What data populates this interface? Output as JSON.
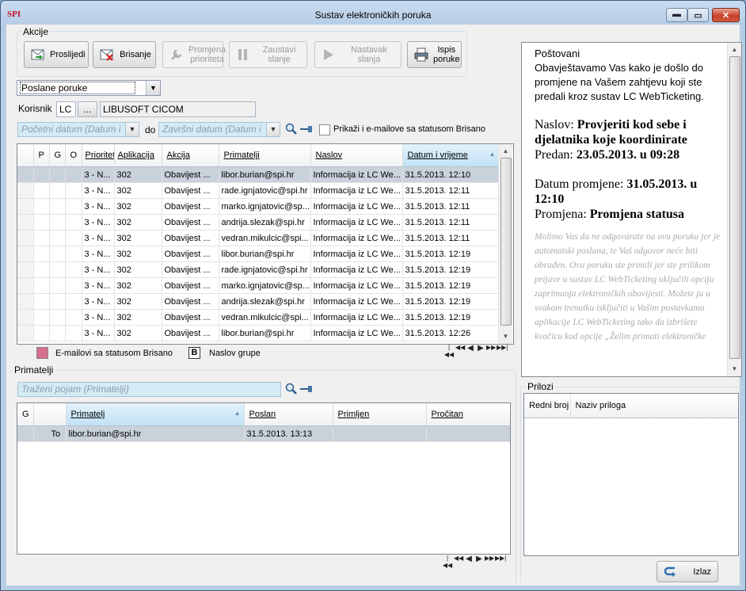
{
  "window": {
    "title": "Sustav elektroničkih poruka",
    "app_logo": "SPI"
  },
  "actions": {
    "group_label": "Akcije",
    "buttons": [
      {
        "label": "Proslijedi",
        "icon": "forward-icon",
        "enabled": true
      },
      {
        "label": "Brisanje",
        "icon": "delete-icon",
        "enabled": true
      },
      {
        "label": "Promjena prioriteta",
        "icon": "wrench-icon",
        "enabled": false
      },
      {
        "label": "Zaustavi slanje",
        "icon": "pause-icon",
        "enabled": false
      },
      {
        "label": "Nastavak slanja",
        "icon": "play-icon",
        "enabled": false
      },
      {
        "label": "Ispis poruke",
        "icon": "printer-icon",
        "enabled": true
      }
    ]
  },
  "filter": {
    "message_type": "Poslane poruke",
    "user_label": "Korisnik",
    "user_code": "LC",
    "user_button": "...",
    "user_name": "LIBUSOFT CICOM",
    "date_from_placeholder": "Početni datum (Datum i",
    "date_sep": "do",
    "date_to_placeholder": "Završni datum (Datum i",
    "show_deleted_label": "Prikaži i e-mailove sa statusom Brisano"
  },
  "messages": {
    "columns": [
      "P",
      "G",
      "O",
      "Prioritet",
      "Aplikacija",
      "Akcija",
      "Primatelji",
      "Naslov",
      "Datum i vrijeme"
    ],
    "rows": [
      [
        "3 - N...",
        "302",
        "Obavijest ...",
        "libor.burian@spi.hr",
        "Informacija iz LC We...",
        "31.5.2013. 12:10"
      ],
      [
        "3 - N...",
        "302",
        "Obavijest ...",
        "rade.ignjatovic@spi.hr",
        "Informacija iz LC We...",
        "31.5.2013. 12:11"
      ],
      [
        "3 - N...",
        "302",
        "Obavijest ...",
        "marko.ignjatovic@sp...",
        "Informacija iz LC We...",
        "31.5.2013. 12:11"
      ],
      [
        "3 - N...",
        "302",
        "Obavijest ...",
        "andrija.slezak@spi.hr",
        "Informacija iz LC We...",
        "31.5.2013. 12:11"
      ],
      [
        "3 - N...",
        "302",
        "Obavijest ...",
        "vedran.mikulcic@spi...",
        "Informacija iz LC We...",
        "31.5.2013. 12:11"
      ],
      [
        "3 - N...",
        "302",
        "Obavijest ...",
        "libor.burian@spi.hr",
        "Informacija iz LC We...",
        "31.5.2013. 12:19"
      ],
      [
        "3 - N...",
        "302",
        "Obavijest ...",
        "rade.ignjatovic@spi.hr",
        "Informacija iz LC We...",
        "31.5.2013. 12:19"
      ],
      [
        "3 - N...",
        "302",
        "Obavijest ...",
        "marko.ignjatovic@sp...",
        "Informacija iz LC We...",
        "31.5.2013. 12:19"
      ],
      [
        "3 - N...",
        "302",
        "Obavijest ...",
        "andrija.slezak@spi.hr",
        "Informacija iz LC We...",
        "31.5.2013. 12:19"
      ],
      [
        "3 - N...",
        "302",
        "Obavijest ...",
        "vedran.mikulcic@spi...",
        "Informacija iz LC We...",
        "31.5.2013. 12:19"
      ],
      [
        "3 - N...",
        "302",
        "Obavijest ...",
        "libor.burian@spi.hr",
        "Informacija iz LC We...",
        "31.5.2013. 12:26"
      ]
    ]
  },
  "legend": {
    "deleted_label": "E-mailovi sa statusom Brisano",
    "group_marker": "B",
    "group_label": "Naslov grupe",
    "deleted_color": "#d6708c"
  },
  "recipients": {
    "group_label": "Primatelji",
    "search_placeholder": "Traženi pojam (Primatelji)",
    "columns": [
      "G",
      "",
      "Primatelj",
      "Poslan",
      "Primljen",
      "Pročitan"
    ],
    "rows": [
      [
        "",
        "To",
        "libor.burian@spi.hr",
        "31.5.2013. 13:13",
        "",
        ""
      ]
    ]
  },
  "preview": {
    "greeting": "Poštovani",
    "intro": "Obavještavamo Vas kako je došlo do promjene na Vašem zahtjevu koji ste predali kroz sustav LC WebTicketing.",
    "subject_label": "Naslov:",
    "subject_value": "Provjeriti kod sebe i djelatnika koje koordinirate",
    "submitted_label": "Predan:",
    "submitted_value": "23.05.2013. u 09:28",
    "change_date_label": "Datum promjene:",
    "change_date_value": "31.05.2013. u 12:10",
    "change_label": "Promjena:",
    "change_value": "Promjena statusa",
    "footer": "Molimo Vas da ne odgovarate na ovu poruku jer je automatski poslana, te Vaš odgovor neće biti obrađen. Ovu poruku ste primili jer ste prilikom prijave u sustav LC WebTicketing uključili opciju zaprimanja elektroničkih obavijesti. Možete ju u svakom trenutku isključiti u Vašim postavkama aplikacije LC WebTicketing tako da izbrišete kvačicu kod opcije „Želim primati elektroničke"
  },
  "attachments": {
    "group_label": "Prilozi",
    "col_no": "Redni broj",
    "col_name": "Naziv priloga"
  },
  "footer": {
    "exit_label": "Izlaz"
  },
  "nav_glyphs": {
    "first": "|◀◀",
    "prev_page": "◀◀",
    "prev": "◀",
    "next": "▶",
    "next_page": "▶▶",
    "last": "▶▶|"
  },
  "colors": {
    "selection": "#c9d1db",
    "date_field": "#d4eaf4",
    "sorted_header": "#c1e2f5"
  }
}
